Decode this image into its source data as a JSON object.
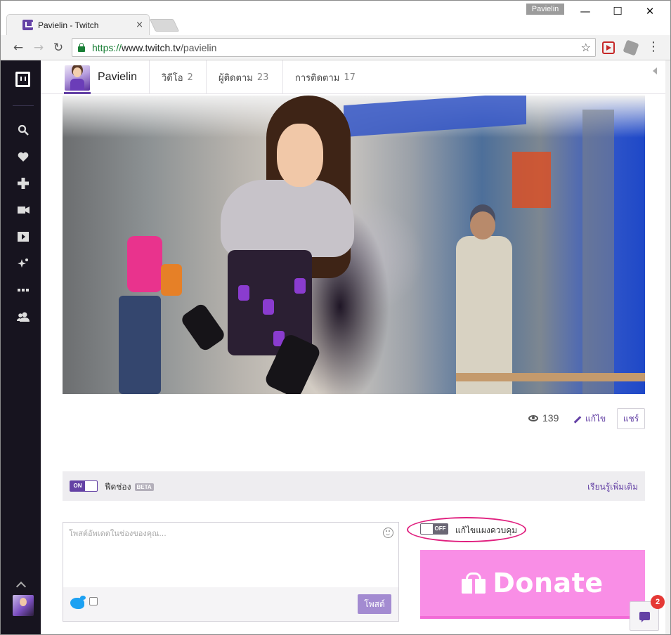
{
  "browser": {
    "tab_title": "Pavielin - Twitch",
    "tab_close": "×",
    "profile_name": "Pavielin",
    "url_scheme": "https://",
    "url_host": "www.twitch.tv",
    "url_path": "/pavielin",
    "nav": {
      "back": "←",
      "forward": "→",
      "reload": "↻"
    },
    "window": {
      "minimize": "—",
      "maximize": "☐",
      "close": "✕"
    },
    "star": "☆",
    "menu": "⋮"
  },
  "rail": {
    "icons": [
      "twitch-logo-icon",
      "search-icon",
      "heart-icon",
      "gamepad-icon",
      "camera-icon",
      "play-icon",
      "sparkle-icon",
      "more-icon",
      "friends-icon"
    ]
  },
  "channel_nav": {
    "name": "Pavielin",
    "items": [
      {
        "label": "วิดีโอ",
        "count": "2"
      },
      {
        "label": "ผู้ติดตาม",
        "count": "23"
      },
      {
        "label": "การติดตาม",
        "count": "17"
      }
    ]
  },
  "stats": {
    "views": "139",
    "edit_label": "แก้ไข",
    "share_label": "แชร์"
  },
  "feed": {
    "toggle_label": "ON",
    "label": "ฟีดช่อง",
    "beta": "BETA",
    "learn_more": "เรียนรู้เพิ่มเติม"
  },
  "composer": {
    "placeholder": "โพสต์อัพเดตในช่องของคุณ...",
    "value": "",
    "post_label": "โพสต์"
  },
  "panel_control": {
    "toggle_label": "OFF",
    "label": "แก้ไขแผงควบคุม"
  },
  "donate": {
    "label": "Donate"
  },
  "chat": {
    "badge_count": "2"
  },
  "colors": {
    "twitch_purple": "#6441a5",
    "rail_bg": "#17141f",
    "donate_pink": "#f98ee6",
    "highlight": "#e0207f",
    "badge_red": "#e53935"
  }
}
